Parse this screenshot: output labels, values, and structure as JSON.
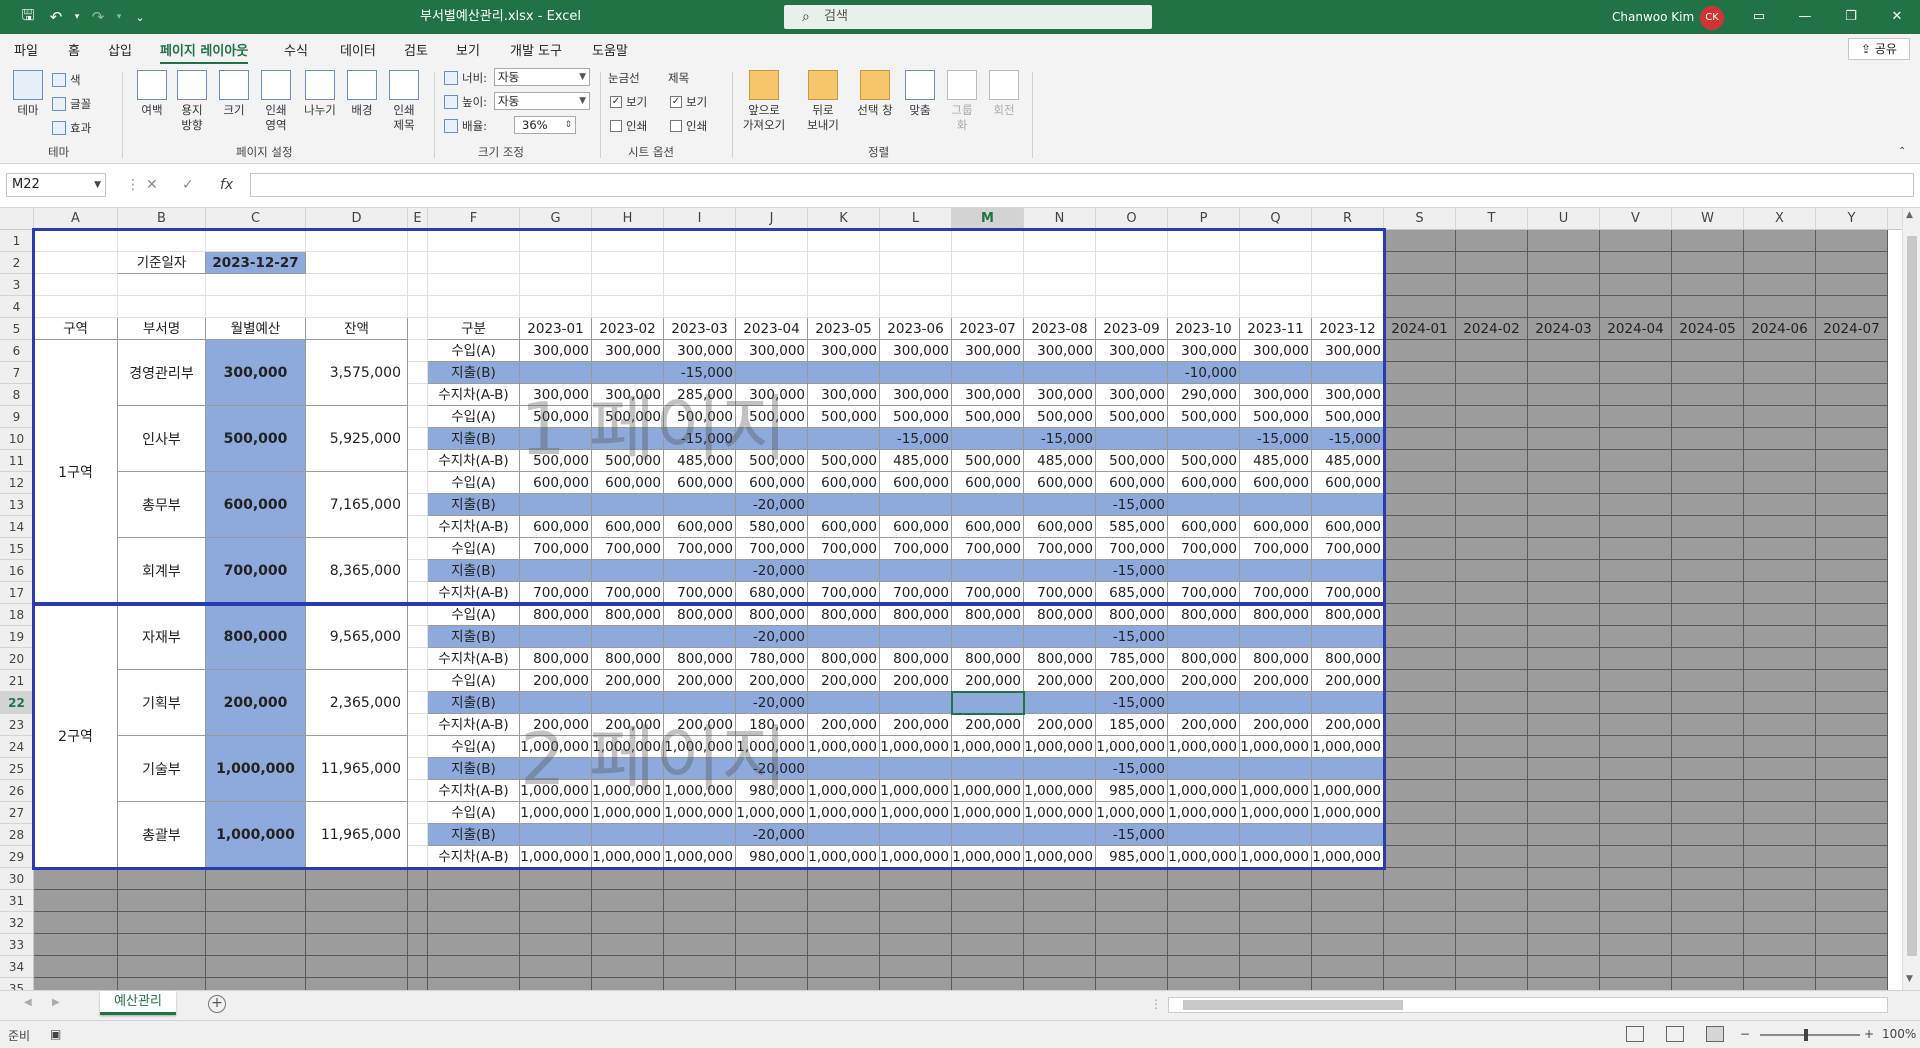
{
  "titlebar": {
    "doc_title": "부서별예산관리.xlsx  -  Excel",
    "search_placeholder": "검색",
    "user_name": "Chanwoo Kim",
    "user_initials": "CK",
    "accent": "#217346"
  },
  "menu": {
    "tabs": [
      "파일",
      "홈",
      "삽입",
      "페이지 레이아웃",
      "수식",
      "데이터",
      "검토",
      "보기",
      "개발 도구",
      "도움말"
    ],
    "active_tab": "페이지 레이아웃",
    "share": "공유"
  },
  "ribbon": {
    "theme": {
      "themes": "테마",
      "colors": "색",
      "fonts": "글꼴",
      "effects": "효과",
      "group": "테마"
    },
    "page_setup": {
      "margins": "여백",
      "orientation": "용지\n방향",
      "size": "크기",
      "print_area": "인쇄\n영역",
      "breaks": "나누기",
      "background": "배경",
      "print_titles": "인쇄\n제목",
      "group": "페이지 설정"
    },
    "scale": {
      "width_label": "너비:",
      "width_value": "자동",
      "height_label": "높이:",
      "height_value": "자동",
      "scale_label": "배율:",
      "scale_value": "36%",
      "group": "크기 조정"
    },
    "sheet_options": {
      "gridlines": "눈금선",
      "headings": "제목",
      "view": "보기",
      "print": "인쇄",
      "group": "시트 옵션"
    },
    "arrange": {
      "bring_forward": "앞으로\n가져오기",
      "send_backward": "뒤로\n보내기",
      "selection_pane": "선택 창",
      "align": "맞춤",
      "group_btn": "그룹\n화",
      "rotate": "회전",
      "group": "정렬"
    }
  },
  "formula_bar": {
    "name_box": "M22",
    "formula": ""
  },
  "columns": [
    "A",
    "B",
    "C",
    "D",
    "E",
    "F",
    "G",
    "H",
    "I",
    "J",
    "K",
    "L",
    "M",
    "N",
    "O",
    "P",
    "Q",
    "R",
    "S",
    "T",
    "U",
    "V",
    "W",
    "X",
    "Y"
  ],
  "selected_column": "M",
  "selected_row": 22,
  "sheet": {
    "base_date_label": "기준일자",
    "base_date_value": "2023-12-27",
    "headers": {
      "region": "구역",
      "dept": "부서명",
      "monthly_budget": "월별예산",
      "balance": "잔액",
      "category": "구분"
    },
    "months_2023": [
      "2023-01",
      "2023-02",
      "2023-03",
      "2023-04",
      "2023-05",
      "2023-06",
      "2023-07",
      "2023-08",
      "2023-09",
      "2023-10",
      "2023-11",
      "2023-12"
    ],
    "months_2024": [
      "2024-01",
      "2024-02",
      "2024-03",
      "2024-04",
      "2024-05",
      "2024-06",
      "2024-07"
    ],
    "row_types": [
      "수입(A)",
      "지출(B)",
      "수지차(A-B)"
    ],
    "regions": [
      {
        "name": "1구역",
        "depts": [
          0,
          1,
          2,
          3
        ]
      },
      {
        "name": "2구역",
        "depts": [
          4,
          5,
          6,
          7
        ]
      }
    ],
    "departments": [
      {
        "name": "경영관리부",
        "budget": "300,000",
        "balance": "3,575,000",
        "income": [
          "300,000",
          "300,000",
          "300,000",
          "300,000",
          "300,000",
          "300,000",
          "300,000",
          "300,000",
          "300,000",
          "300,000",
          "300,000",
          "300,000"
        ],
        "expense": [
          "",
          "",
          "-15,000",
          "",
          "",
          "",
          "",
          "",
          "",
          "-10,000",
          "",
          ""
        ],
        "diff": [
          "300,000",
          "300,000",
          "285,000",
          "300,000",
          "300,000",
          "300,000",
          "300,000",
          "300,000",
          "300,000",
          "290,000",
          "300,000",
          "300,000"
        ]
      },
      {
        "name": "인사부",
        "budget": "500,000",
        "balance": "5,925,000",
        "income": [
          "500,000",
          "500,000",
          "500,000",
          "500,000",
          "500,000",
          "500,000",
          "500,000",
          "500,000",
          "500,000",
          "500,000",
          "500,000",
          "500,000"
        ],
        "expense": [
          "",
          "",
          "-15,000",
          "",
          "",
          "-15,000",
          "",
          "-15,000",
          "",
          "",
          "-15,000",
          "-15,000"
        ],
        "diff": [
          "500,000",
          "500,000",
          "485,000",
          "500,000",
          "500,000",
          "485,000",
          "500,000",
          "485,000",
          "500,000",
          "500,000",
          "485,000",
          "485,000"
        ]
      },
      {
        "name": "총무부",
        "budget": "600,000",
        "balance": "7,165,000",
        "income": [
          "600,000",
          "600,000",
          "600,000",
          "600,000",
          "600,000",
          "600,000",
          "600,000",
          "600,000",
          "600,000",
          "600,000",
          "600,000",
          "600,000"
        ],
        "expense": [
          "",
          "",
          "",
          "-20,000",
          "",
          "",
          "",
          "",
          "-15,000",
          "",
          "",
          ""
        ],
        "diff": [
          "600,000",
          "600,000",
          "600,000",
          "580,000",
          "600,000",
          "600,000",
          "600,000",
          "600,000",
          "585,000",
          "600,000",
          "600,000",
          "600,000"
        ]
      },
      {
        "name": "회계부",
        "budget": "700,000",
        "balance": "8,365,000",
        "income": [
          "700,000",
          "700,000",
          "700,000",
          "700,000",
          "700,000",
          "700,000",
          "700,000",
          "700,000",
          "700,000",
          "700,000",
          "700,000",
          "700,000"
        ],
        "expense": [
          "",
          "",
          "",
          "-20,000",
          "",
          "",
          "",
          "",
          "-15,000",
          "",
          "",
          ""
        ],
        "diff": [
          "700,000",
          "700,000",
          "700,000",
          "680,000",
          "700,000",
          "700,000",
          "700,000",
          "700,000",
          "685,000",
          "700,000",
          "700,000",
          "700,000"
        ]
      },
      {
        "name": "자재부",
        "budget": "800,000",
        "balance": "9,565,000",
        "income": [
          "800,000",
          "800,000",
          "800,000",
          "800,000",
          "800,000",
          "800,000",
          "800,000",
          "800,000",
          "800,000",
          "800,000",
          "800,000",
          "800,000"
        ],
        "expense": [
          "",
          "",
          "",
          "-20,000",
          "",
          "",
          "",
          "",
          "-15,000",
          "",
          "",
          ""
        ],
        "diff": [
          "800,000",
          "800,000",
          "800,000",
          "780,000",
          "800,000",
          "800,000",
          "800,000",
          "800,000",
          "785,000",
          "800,000",
          "800,000",
          "800,000"
        ]
      },
      {
        "name": "기획부",
        "budget": "200,000",
        "balance": "2,365,000",
        "income": [
          "200,000",
          "200,000",
          "200,000",
          "200,000",
          "200,000",
          "200,000",
          "200,000",
          "200,000",
          "200,000",
          "200,000",
          "200,000",
          "200,000"
        ],
        "expense": [
          "",
          "",
          "",
          "-20,000",
          "",
          "",
          "",
          "",
          "-15,000",
          "",
          "",
          ""
        ],
        "diff": [
          "200,000",
          "200,000",
          "200,000",
          "180,000",
          "200,000",
          "200,000",
          "200,000",
          "200,000",
          "185,000",
          "200,000",
          "200,000",
          "200,000"
        ]
      },
      {
        "name": "기술부",
        "budget": "1,000,000",
        "balance": "11,965,000",
        "income": [
          "1,000,000",
          "1,000,000",
          "1,000,000",
          "1,000,000",
          "1,000,000",
          "1,000,000",
          "1,000,000",
          "1,000,000",
          "1,000,000",
          "1,000,000",
          "1,000,000",
          "1,000,000"
        ],
        "expense": [
          "",
          "",
          "",
          "-20,000",
          "",
          "",
          "",
          "",
          "-15,000",
          "",
          "",
          ""
        ],
        "diff": [
          "1,000,000",
          "1,000,000",
          "1,000,000",
          "980,000",
          "1,000,000",
          "1,000,000",
          "1,000,000",
          "1,000,000",
          "985,000",
          "1,000,000",
          "1,000,000",
          "1,000,000"
        ]
      },
      {
        "name": "총괄부",
        "budget": "1,000,000",
        "balance": "11,965,000",
        "income": [
          "1,000,000",
          "1,000,000",
          "1,000,000",
          "1,000,000",
          "1,000,000",
          "1,000,000",
          "1,000,000",
          "1,000,000",
          "1,000,000",
          "1,000,000",
          "1,000,000",
          "1,000,000"
        ],
        "expense": [
          "",
          "",
          "",
          "-20,000",
          "",
          "",
          "",
          "",
          "-15,000",
          "",
          "",
          ""
        ],
        "diff": [
          "1,000,000",
          "1,000,000",
          "1,000,000",
          "980,000",
          "1,000,000",
          "1,000,000",
          "1,000,000",
          "1,000,000",
          "985,000",
          "1,000,000",
          "1,000,000",
          "1,000,000"
        ]
      }
    ],
    "page_watermarks": [
      "1 페이지",
      "2 페이지"
    ]
  },
  "sheet_tabs": {
    "active": "예산관리"
  },
  "status": {
    "ready": "준비",
    "zoom": "100%"
  },
  "colors": {
    "blue_fill": "#8ea9db",
    "page_break": "#2a3bb0",
    "outside_print_area": "#9c9c9c"
  }
}
